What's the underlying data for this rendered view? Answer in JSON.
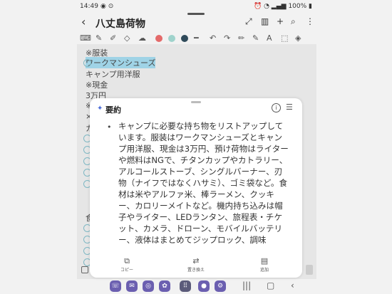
{
  "status": {
    "time": "14:49",
    "battery": "100%"
  },
  "note": {
    "title": "八丈島荷物",
    "lines": [
      "※服装",
      "ワークマンシューズ",
      "キャンプ用洋服",
      "※現金",
      "3万円",
      "※",
      "×",
      "カ"
    ],
    "lower_char": "食"
  },
  "summary": {
    "title": "要約",
    "body": "キャンプに必要な持ち物をリストアップしています。服装はワークマンシューズとキャンプ用洋服、現金は3万円、預け荷物はライターや燃料はNGで、チタンカップやカトラリー、アルコールストーブ、シングルバーナー、刃物（ナイフではなくハサミ）、ゴミ袋など。食材は米やアルファ米、棒ラーメン、クッキー、カロリーメイトなど。機内持ち込みは帽子やライター、LEDランタン、旅程表・チケット、カメラ、ドローン、モバイルバッテリー、液体はまとめてジップロック、調味",
    "actions": {
      "copy": "コピー",
      "replace": "置き換え",
      "add": "追加"
    }
  },
  "colors": {
    "pen_red": "#e46a6a",
    "pen_teal": "#9fd3cc",
    "pen_navy": "#2f4a5a",
    "highlight": "#9fd3e6"
  }
}
